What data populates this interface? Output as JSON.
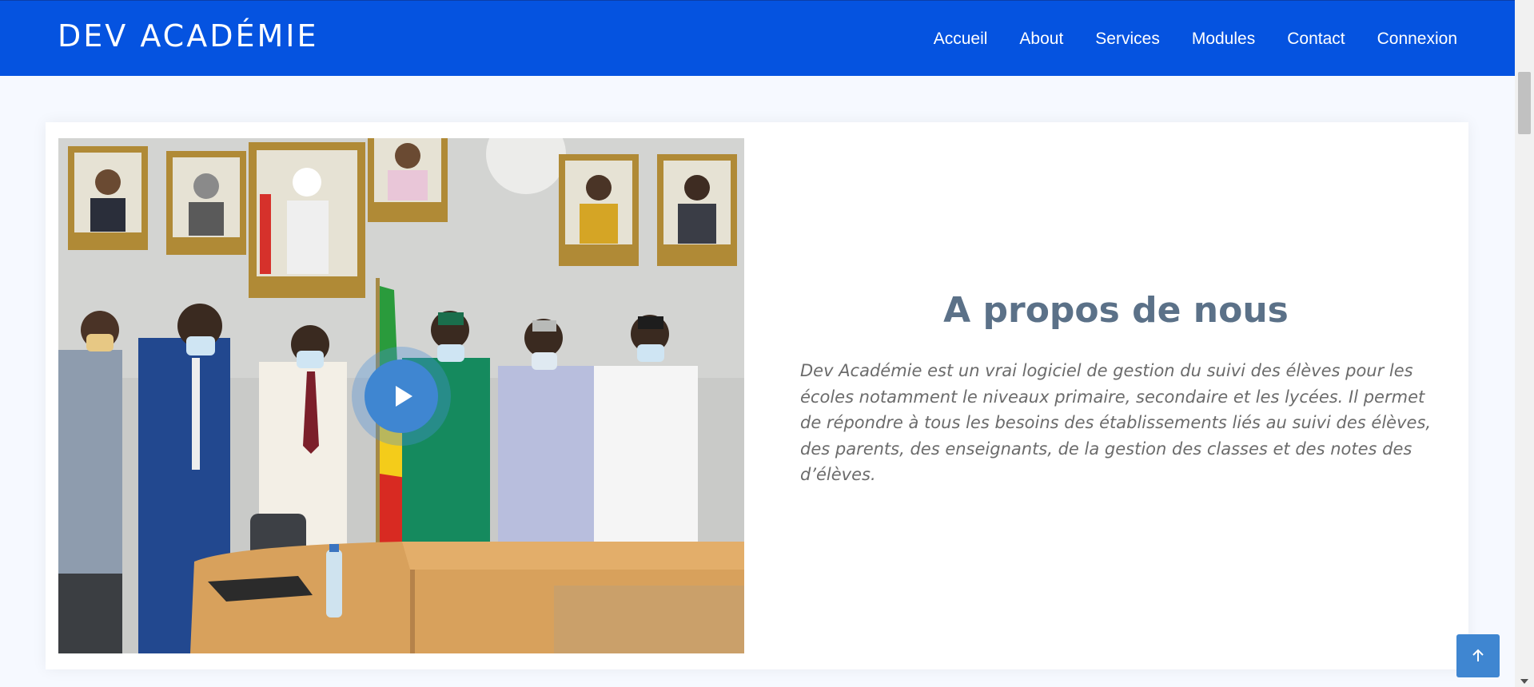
{
  "header": {
    "brand": "DEV ACADÉMIE",
    "nav": [
      "Accueil",
      "About",
      "Services",
      "Modules",
      "Contact",
      "Connexion"
    ]
  },
  "about": {
    "title": "A propos de nous",
    "description": "Dev Académie est un vrai logiciel de gestion du suivi des élèves pour les écoles notamment le niveaux primaire, secondaire et les lycées. Il permet de répondre à tous les besoins des établissements liés au suivi des élèves, des parents, des enseignants, de la gestion des classes et des notes des d’élèves.",
    "media_icon": "play-icon"
  },
  "colors": {
    "header_bg": "#0553e0",
    "accent": "#3f86d1",
    "title": "#5b7188",
    "body_text": "#6b6b6b"
  },
  "back_to_top_icon": "arrow-up-icon"
}
